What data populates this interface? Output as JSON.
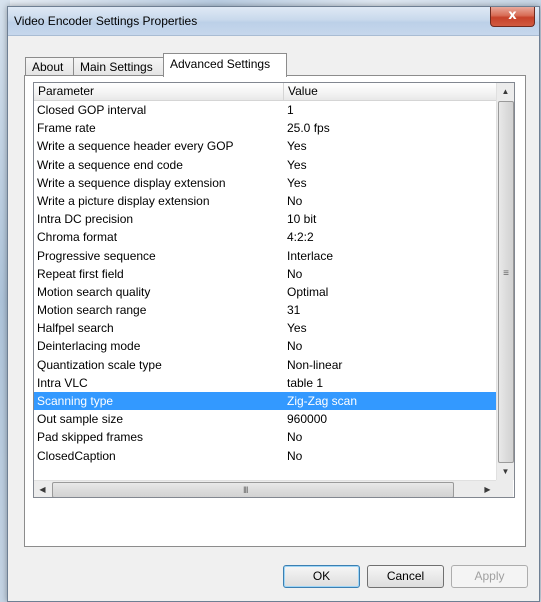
{
  "window": {
    "title": "Video Encoder Settings Properties",
    "close_label": "x"
  },
  "tabs": [
    {
      "label": "About"
    },
    {
      "label": "Main Settings"
    },
    {
      "label": "Advanced Settings"
    }
  ],
  "grid": {
    "headers": {
      "parameter": "Parameter",
      "value": "Value"
    },
    "rows": [
      {
        "param": "Closed GOP interval",
        "value": "1"
      },
      {
        "param": "Frame rate",
        "value": "25.0  fps"
      },
      {
        "param": "Write a sequence header every GOP",
        "value": "Yes"
      },
      {
        "param": "Write a sequence end code",
        "value": "Yes"
      },
      {
        "param": "Write a sequence display extension",
        "value": "Yes"
      },
      {
        "param": "Write a picture display extension",
        "value": "No"
      },
      {
        "param": "Intra DC precision",
        "value": "10 bit"
      },
      {
        "param": "Chroma format",
        "value": "4:2:2"
      },
      {
        "param": "Progressive sequence",
        "value": "Interlace"
      },
      {
        "param": "Repeat first field",
        "value": "No"
      },
      {
        "param": "Motion search quality",
        "value": "Optimal"
      },
      {
        "param": "Motion search range",
        "value": "31"
      },
      {
        "param": "Halfpel search",
        "value": "Yes"
      },
      {
        "param": "Deinterlacing mode",
        "value": "No"
      },
      {
        "param": "Quantization scale type",
        "value": "Non-linear"
      },
      {
        "param": "Intra VLC",
        "value": "table 1"
      },
      {
        "param": "Scanning type",
        "value": "Zig-Zag scan"
      },
      {
        "param": "Out sample size",
        "value": "960000"
      },
      {
        "param": "Pad skipped frames",
        "value": "No"
      },
      {
        "param": "ClosedCaption",
        "value": "No"
      }
    ],
    "selected_row": "Scanning type"
  },
  "scrollbars": {
    "v_grip": "≡",
    "h_grip": "III"
  },
  "buttons": {
    "ok": "OK",
    "cancel": "Cancel",
    "apply": "Apply"
  },
  "colors": {
    "selection": "#3399ff",
    "close_button": "#c7422a"
  }
}
